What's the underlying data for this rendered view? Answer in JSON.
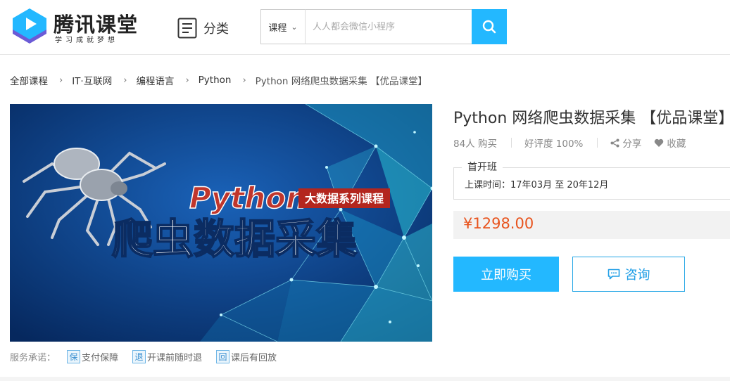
{
  "header": {
    "logo": {
      "title": "腾讯课堂",
      "slogan": "学习成就梦想",
      "icon": "play-logo-icon",
      "colors": {
        "primary": "#23b8ff",
        "secondary": "#6b5bd6"
      }
    },
    "category_label": "分类",
    "search": {
      "type_label": "课程",
      "placeholder": "人人都会微信小程序",
      "button_icon": "search-icon"
    }
  },
  "breadcrumb": [
    "全部课程",
    "IT·互联网",
    "编程语言",
    "Python",
    "Python 网络爬虫数据采集 【优品课堂】"
  ],
  "cover": {
    "title_en": "Python",
    "tag": "大数据系列课程",
    "title_cn": "爬虫数据采集"
  },
  "service": {
    "label": "服务承诺：",
    "items": [
      {
        "icon_char": "保",
        "label": "支付保障"
      },
      {
        "icon_char": "退",
        "label": "开课前随时退"
      },
      {
        "icon_char": "回",
        "label": "课后有回放"
      }
    ]
  },
  "course": {
    "title": "Python 网络爬虫数据采集 【优品课堂】",
    "buyers": "84人 购买",
    "rating": "好评度 100%",
    "share_label": "分享",
    "favorite_label": "收藏",
    "class_name": "首开班",
    "class_time": "上课时间：17年03月 至 20年12月",
    "price": "¥1298.00",
    "buy_label": "立即购买",
    "consult_label": "咨询"
  },
  "colors": {
    "accent": "#23b8ff",
    "price": "#e8541e",
    "cover_bg": "#0c3f86",
    "cover_title_en": "#c0362c",
    "cover_tag_bg": "#b3261e"
  }
}
